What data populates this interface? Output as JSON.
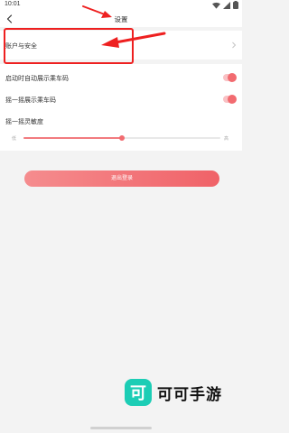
{
  "status_bar": {
    "time": "10:01"
  },
  "header": {
    "title": "设置"
  },
  "account_row": {
    "label": "账户与安全"
  },
  "settings": {
    "auto_show_code": {
      "label": "启动时自动展示乘车码",
      "enabled": true
    },
    "shake_show_code": {
      "label": "摇一摇展示乘车码",
      "enabled": true
    },
    "shake_sensitivity": {
      "label": "摇一摇灵敏度",
      "low_label": "低",
      "high_label": "高",
      "level": 0.5
    }
  },
  "logout_button": {
    "label": "退出登录"
  },
  "watermark": {
    "logo_glyph": "可",
    "text": "可可手游"
  },
  "colors": {
    "accent": "#f26b70",
    "annotation": "#ee2020",
    "watermark_logo": "#1ccdb5"
  }
}
